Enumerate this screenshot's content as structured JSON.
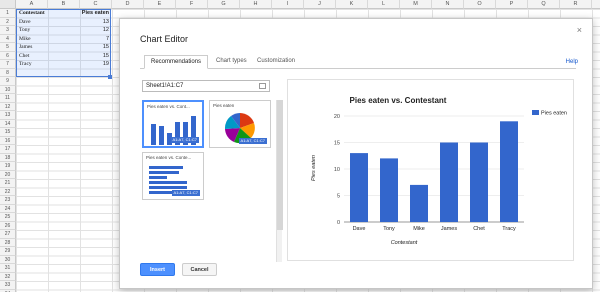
{
  "sheet": {
    "columns": [
      "A",
      "B",
      "C",
      "D",
      "E",
      "F",
      "G",
      "H",
      "I",
      "J",
      "K",
      "L",
      "M",
      "N",
      "O",
      "P",
      "Q",
      "R",
      "S"
    ],
    "rows": [
      "1",
      "2",
      "3",
      "4",
      "5",
      "6",
      "7",
      "8",
      "9",
      "10",
      "11",
      "12",
      "13",
      "14",
      "15",
      "16",
      "17",
      "18",
      "19",
      "20",
      "21",
      "22",
      "23",
      "24",
      "25",
      "26",
      "27",
      "28",
      "29",
      "30",
      "31",
      "32",
      "33",
      "34"
    ],
    "header": {
      "name": "Contestant",
      "value": "Pies eaten"
    },
    "data": [
      {
        "name": "Dave",
        "value": "13"
      },
      {
        "name": "Tony",
        "value": "12"
      },
      {
        "name": "Mike",
        "value": "7"
      },
      {
        "name": "James",
        "value": "15"
      },
      {
        "name": "Chet",
        "value": "15"
      },
      {
        "name": "Tracy",
        "value": "19"
      }
    ]
  },
  "dialog": {
    "title": "Chart Editor",
    "close_label": "×",
    "tabs": [
      "Recommendations",
      "Chart types",
      "Customization"
    ],
    "help_label": "Help",
    "range_value": "Sheet1!A1:C7",
    "thumbnails": [
      {
        "label": "Pies eaten vs. Cont...",
        "tag": "A1:A7, C1:C7"
      },
      {
        "label": "Pies eaten",
        "tag": "A1:A7, C1:C7"
      },
      {
        "label": "Pies eaten vs. Conte...",
        "tag": "A1:A7, C1:C7"
      }
    ],
    "insert_label": "Insert",
    "cancel_label": "Cancel"
  },
  "chart_data": {
    "type": "bar",
    "title": "Pies eaten vs. Contestant",
    "xlabel": "Contestant",
    "ylabel": "Pies eaten",
    "categories": [
      "Dave",
      "Tony",
      "Mike",
      "James",
      "Chet",
      "Tracy"
    ],
    "series": [
      {
        "name": "Pies eaten",
        "values": [
          13,
          12,
          7,
          15,
          15,
          19
        ],
        "color": "#3366cc"
      }
    ],
    "ylim": [
      0,
      20
    ],
    "yticks": [
      "0",
      "5",
      "10",
      "15",
      "20"
    ],
    "grid": true,
    "legend": "right"
  }
}
